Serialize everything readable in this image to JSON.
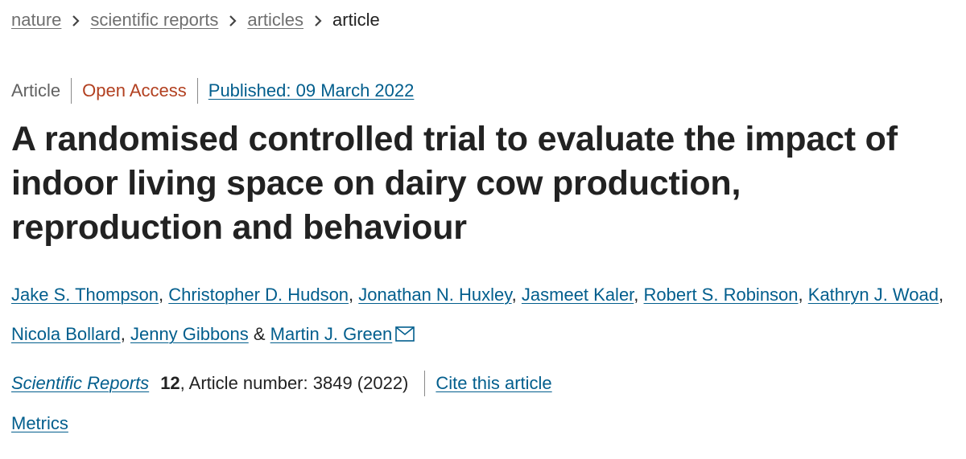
{
  "breadcrumb": {
    "items": [
      "nature",
      "scientific reports",
      "articles"
    ],
    "current": "article"
  },
  "meta": {
    "type": "Article",
    "access": "Open Access",
    "published": "Published: 09 March 2022"
  },
  "title": "A randomised controlled trial to evaluate the impact of indoor living space on dairy cow production, reproduction and behaviour",
  "authors": {
    "list": [
      "Jake S. Thompson",
      "Christopher D. Hudson",
      "Jonathan N. Huxley",
      "Jasmeet Kaler",
      "Robert S. Robinson",
      "Kathryn J. Woad",
      "Nicola Bollard",
      "Jenny Gibbons",
      "Martin J. Green"
    ],
    "separator": ", ",
    "last_separator": " & ",
    "corresponding_icon": "mail-icon"
  },
  "citation": {
    "journal": "Scientific Reports",
    "volume": "12",
    "article_number": ", Article number: 3849 (2022)",
    "cite_link": "Cite this article"
  },
  "metrics": "Metrics",
  "colors": {
    "link": "#025e8d",
    "open_access": "#b24020",
    "breadcrumb": "#6f6f6f",
    "text": "#222222"
  }
}
